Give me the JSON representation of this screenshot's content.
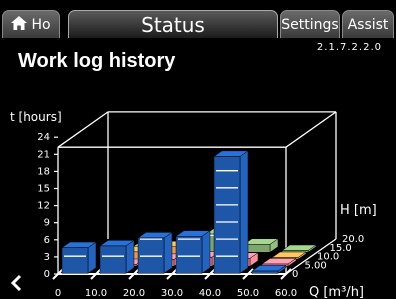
{
  "tabs": {
    "home_label": "Ho",
    "status_label": "Status",
    "settings_label": "Settings",
    "assist_label": "Assist"
  },
  "version": "2.1.7.2.2.0",
  "page_title": "Work log history",
  "chart_data": {
    "type": "bar3d",
    "ylabel": "t [hours]",
    "xlabel": "Q [m³/h]",
    "zlabel": "H [m]",
    "y_ticks": [
      "0",
      "3",
      "6",
      "9",
      "12",
      "15",
      "18",
      "21",
      "24"
    ],
    "x_ticks": [
      "0",
      "10.0",
      "20.0",
      "30.0",
      "40.0",
      "50.0",
      "60.0"
    ],
    "z_ticks": [
      "0",
      "5.00",
      "10.0",
      "15.0",
      "20.0"
    ],
    "ylim": [
      0,
      24
    ],
    "series": [
      {
        "color": "#1e57a8",
        "values": [
          4.5,
          4.8,
          6.2,
          6.5,
          20.5,
          0.4
        ]
      },
      {
        "color": "#e07c8b",
        "values": [
          0,
          0.3,
          1.2,
          1.6,
          1.4,
          0.4
        ]
      },
      {
        "color": "#ee9a48",
        "values": [
          0,
          1.3,
          2.2,
          0,
          0,
          0.3
        ]
      },
      {
        "color": "#7fa56e",
        "values": [
          0,
          0.6,
          1.0,
          3.2,
          1.4,
          0.3
        ]
      },
      {
        "color": "#8bb0d6",
        "values": [
          0,
          0,
          0,
          0,
          0,
          0
        ]
      }
    ]
  },
  "colors": {
    "grid": "#ffffff",
    "frame": "#ffffff"
  }
}
